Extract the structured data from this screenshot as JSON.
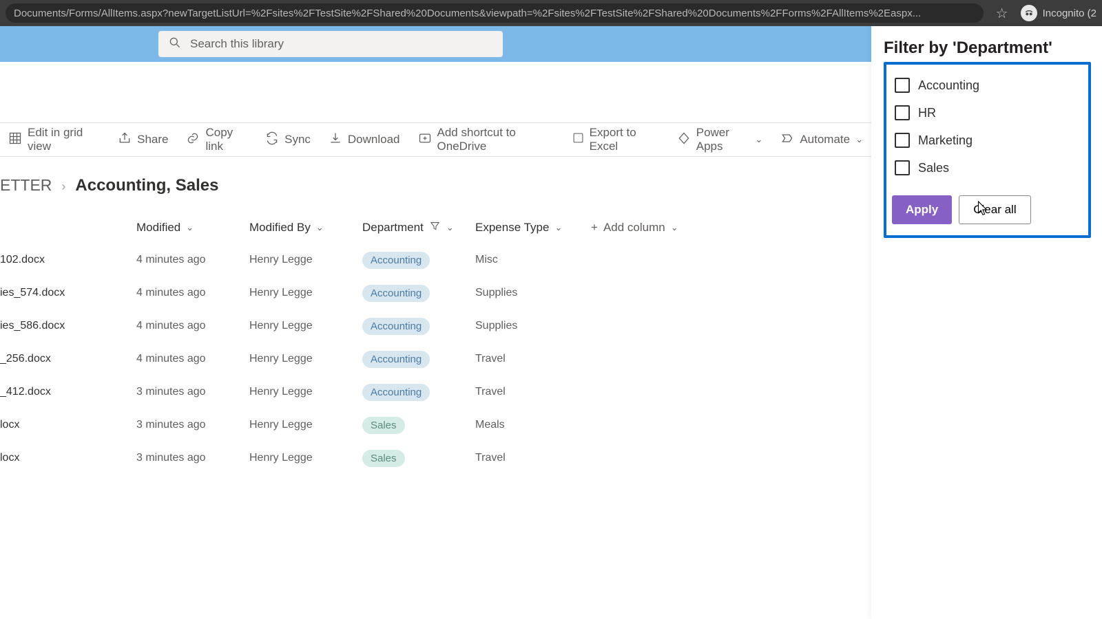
{
  "browser": {
    "url": "Documents/Forms/AllItems.aspx?newTargetListUrl=%2Fsites%2FTestSite%2FShared%20Documents&viewpath=%2Fsites%2FTestSite%2FShared%20Documents%2FForms%2FAllItems%2Easpx...",
    "incognito_label": "Incognito (2"
  },
  "search": {
    "placeholder": "Search this library"
  },
  "commands": {
    "edit_grid": "Edit in grid view",
    "share": "Share",
    "copy_link": "Copy link",
    "sync": "Sync",
    "download": "Download",
    "add_shortcut": "Add shortcut to OneDrive",
    "export_excel": "Export to Excel",
    "power_apps": "Power Apps",
    "automate": "Automate"
  },
  "breadcrumb": {
    "parent": "ETTER",
    "filter_label": "Accounting, Sales"
  },
  "columns": {
    "modified": "Modified",
    "modified_by": "Modified By",
    "department": "Department",
    "expense_type": "Expense Type",
    "add_column": "Add column"
  },
  "rows": [
    {
      "name": "102.docx",
      "modified": "4 minutes ago",
      "by": "Henry Legge",
      "dept": "Accounting",
      "dept_class": "acc",
      "expense": "Misc"
    },
    {
      "name": "ies_574.docx",
      "modified": "4 minutes ago",
      "by": "Henry Legge",
      "dept": "Accounting",
      "dept_class": "acc",
      "expense": "Supplies"
    },
    {
      "name": "ies_586.docx",
      "modified": "4 minutes ago",
      "by": "Henry Legge",
      "dept": "Accounting",
      "dept_class": "acc",
      "expense": "Supplies"
    },
    {
      "name": "_256.docx",
      "modified": "4 minutes ago",
      "by": "Henry Legge",
      "dept": "Accounting",
      "dept_class": "acc",
      "expense": "Travel"
    },
    {
      "name": "_412.docx",
      "modified": "3 minutes ago",
      "by": "Henry Legge",
      "dept": "Accounting",
      "dept_class": "acc",
      "expense": "Travel"
    },
    {
      "name": "locx",
      "modified": "3 minutes ago",
      "by": "Henry Legge",
      "dept": "Sales",
      "dept_class": "sales",
      "expense": "Meals"
    },
    {
      "name": "locx",
      "modified": "3 minutes ago",
      "by": "Henry Legge",
      "dept": "Sales",
      "dept_class": "sales",
      "expense": "Travel"
    }
  ],
  "filter_panel": {
    "title": "Filter by 'Department'",
    "options": [
      "Accounting",
      "HR",
      "Marketing",
      "Sales"
    ],
    "apply": "Apply",
    "clear": "Clear all"
  }
}
